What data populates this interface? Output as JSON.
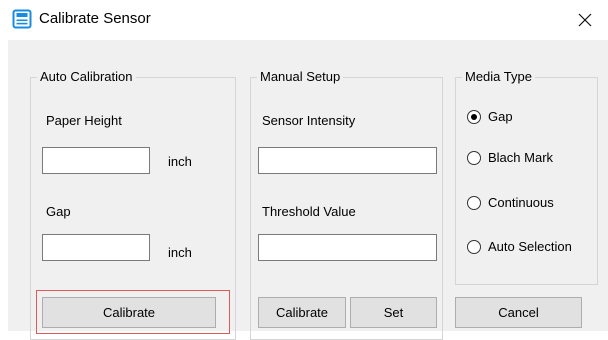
{
  "window": {
    "title": "Calibrate Sensor",
    "close_glyph": "✕",
    "accent_color": "#1a8ce0"
  },
  "auto_calibration": {
    "title": "Auto Calibration",
    "paper_height_label": "Paper Height",
    "paper_height_value": "",
    "paper_height_unit": "inch",
    "gap_label": "Gap",
    "gap_value": "",
    "gap_unit": "inch",
    "calibrate_label": "Calibrate"
  },
  "manual_setup": {
    "title": "Manual Setup",
    "sensor_intensity_label": "Sensor Intensity",
    "sensor_intensity_value": "",
    "threshold_value_label": "Threshold Value",
    "threshold_value_value": "",
    "calibrate_label": "Calibrate",
    "set_label": "Set"
  },
  "media_type": {
    "title": "Media Type",
    "options": [
      {
        "label": "Gap",
        "checked": true
      },
      {
        "label": "Blach Mark",
        "checked": false
      },
      {
        "label": "Continuous",
        "checked": false
      },
      {
        "label": "Auto Selection",
        "checked": false
      }
    ],
    "cancel_label": "Cancel"
  },
  "icons": {
    "app": "printer-window-icon",
    "close": "close-icon"
  }
}
